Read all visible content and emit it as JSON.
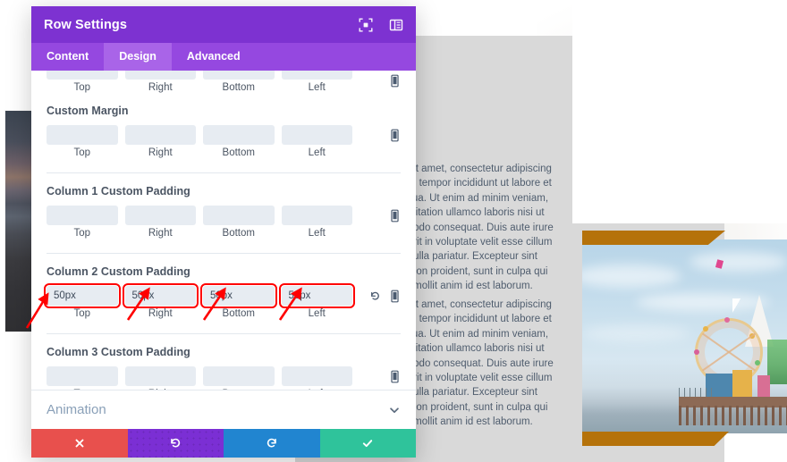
{
  "modal": {
    "title": "Row Settings",
    "header_icons": [
      {
        "name": "fullscreen-icon",
        "glyph": "expand"
      },
      {
        "name": "layout-toggle-icon",
        "glyph": "columns"
      }
    ],
    "tabs": [
      {
        "label": "Content",
        "active": false
      },
      {
        "label": "Design",
        "active": true
      },
      {
        "label": "Advanced",
        "active": false
      }
    ],
    "side_labels": [
      "Top",
      "Right",
      "Bottom",
      "Left"
    ],
    "groups": [
      {
        "label": "",
        "cut_off": true,
        "values": [
          "",
          "",
          "",
          ""
        ],
        "highlighted": false,
        "has_reset": false
      },
      {
        "label": "Custom Margin",
        "cut_off": false,
        "values": [
          "",
          "",
          "",
          ""
        ],
        "highlighted": false,
        "has_reset": false
      },
      {
        "label": "Column 1 Custom Padding",
        "cut_off": false,
        "values": [
          "",
          "",
          "",
          ""
        ],
        "highlighted": false,
        "has_reset": false
      },
      {
        "label": "Column 2 Custom Padding",
        "cut_off": false,
        "values": [
          "50px",
          "50px",
          "50px",
          "50px"
        ],
        "highlighted": true,
        "has_reset": true
      },
      {
        "label": "Column 3 Custom Padding",
        "cut_off": false,
        "values": [
          "",
          "",
          "",
          ""
        ],
        "highlighted": false,
        "has_reset": false
      }
    ],
    "toggle_section": {
      "title": "Animation",
      "chevron": "chevron-down-icon"
    },
    "footer": [
      {
        "name": "cancel-button",
        "icon": "close-icon",
        "color": "#e8504d"
      },
      {
        "name": "undo-button",
        "icon": "undo-icon",
        "color": "#7b2fd4"
      },
      {
        "name": "redo-button",
        "icon": "redo-icon",
        "color": "#2185d0"
      },
      {
        "name": "save-button",
        "icon": "check-icon",
        "color": "#2fc39b"
      }
    ]
  },
  "background": {
    "text_blocks": [
      [
        "or sit amet, consectetur adipiscing",
        "mod tempor incididunt ut labore et",
        "aliqua. Ut enim ad minim veniam,",
        "xercitation ullamco laboris nisi ut",
        "mmodo consequat. Duis aute irure",
        "nderit in voluptate velit esse cillum",
        "at nulla pariatur. Excepteur sint",
        "tat non proident, sunt in culpa qui",
        "unt mollit anim id est laborum."
      ],
      [
        "or sit amet, consectetur adipiscing",
        "mod tempor incididunt ut labore et",
        "aliqua. Ut enim ad minim veniam,",
        "xercitation ullamco laboris nisi ut",
        "mmodo consequat. Duis aute irure",
        "nderit in voluptate velit esse cillum",
        "at nulla pariatur. Excepteur sint",
        "tat non proident, sunt in culpa qui",
        "unt mollit anim id est laborum."
      ]
    ],
    "left_image": "dark-beach-sunset-photo",
    "right_image": "santa-monica-pier-ferris-wheel-photo",
    "divider_color": "#b5720a"
  },
  "annotations": {
    "arrow_color": "#ff0000",
    "highlight_color": "#ff0000",
    "arrow_count": 5
  },
  "colors": {
    "header_purple": "#7d32d1",
    "tabbar_purple": "#9548e0",
    "tab_active_purple": "#a964e8",
    "input_bg": "#e7ecf2",
    "label_text": "#4b5563"
  }
}
